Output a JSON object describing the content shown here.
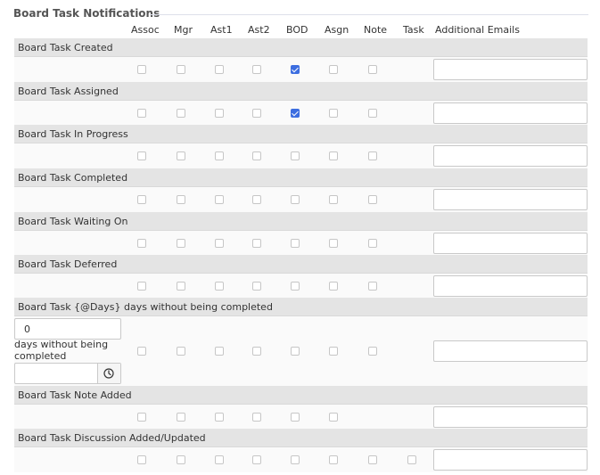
{
  "section": {
    "title": "Board Task Notifications"
  },
  "columns": [
    "Assoc",
    "Mgr",
    "Ast1",
    "Ast2",
    "BOD",
    "Asgn",
    "Note",
    "Task",
    "Additional Emails"
  ],
  "rows": [
    {
      "label": "Board Task Created",
      "checks": [
        false,
        false,
        false,
        false,
        true,
        false,
        false
      ],
      "email": ""
    },
    {
      "label": "Board Task Assigned",
      "checks": [
        false,
        false,
        false,
        false,
        true,
        false,
        false
      ],
      "email": ""
    },
    {
      "label": "Board Task In Progress",
      "checks": [
        false,
        false,
        false,
        false,
        false,
        false,
        false
      ],
      "email": ""
    },
    {
      "label": "Board Task Completed",
      "checks": [
        false,
        false,
        false,
        false,
        false,
        false,
        false
      ],
      "email": ""
    },
    {
      "label": "Board Task Waiting On",
      "checks": [
        false,
        false,
        false,
        false,
        false,
        false,
        false
      ],
      "email": ""
    },
    {
      "label": "Board Task Deferred",
      "checks": [
        false,
        false,
        false,
        false,
        false,
        false,
        false
      ],
      "email": ""
    },
    {
      "label": "Board Task {@Days} days without being completed",
      "checks": [
        false,
        false,
        false,
        false,
        false,
        false,
        false
      ],
      "days_value": "0",
      "days_caption": "days without being completed",
      "time_value": "",
      "email": ""
    },
    {
      "label": "Board Task Note Added",
      "checks": [
        false,
        false,
        false,
        false,
        false,
        false
      ],
      "email": ""
    },
    {
      "label": "Board Task Discussion Added/Updated",
      "checks": [
        false,
        false,
        false,
        false,
        false,
        false,
        false,
        false
      ],
      "email": ""
    }
  ],
  "icons": {
    "time": "clock-icon"
  },
  "colors": {
    "checked": "#3d6ee0",
    "band": "#e4e4e4"
  }
}
